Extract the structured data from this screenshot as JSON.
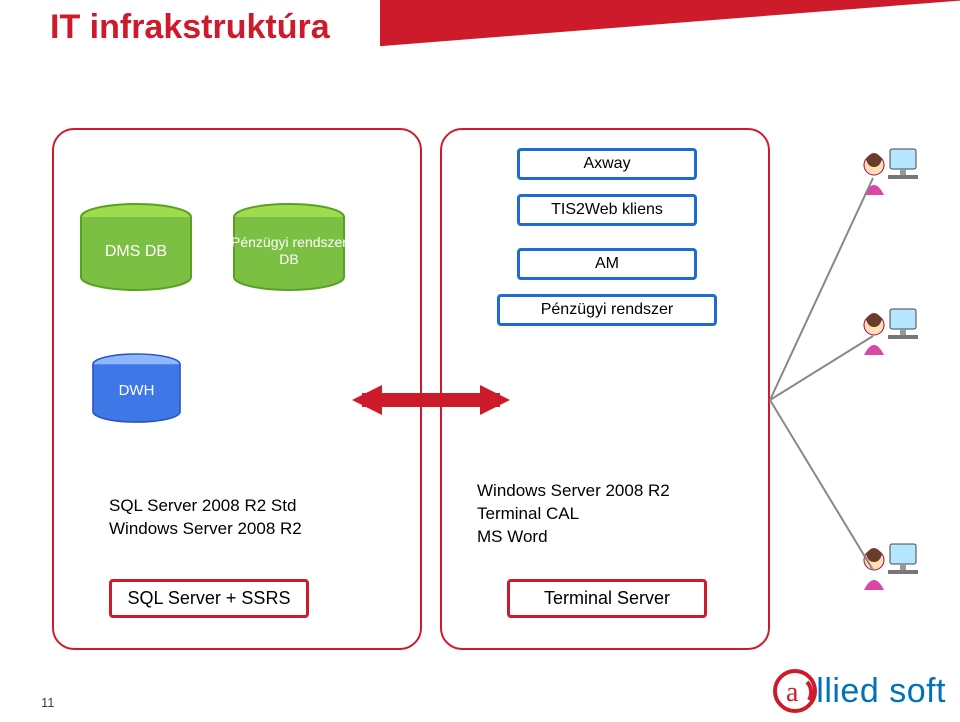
{
  "title": "IT infrakstruktúra",
  "page_number": "11",
  "logo_text": "llied soft",
  "left_panel": {
    "db_dms": "DMS DB",
    "db_fin": "Pénzügyi rendszer DB",
    "db_dwh": "DWH",
    "sql_line1": "SQL Server 2008 R2 Std",
    "sql_line2": "Windows Server 2008 R2",
    "footer_box": "SQL Server + SSRS"
  },
  "right_panel": {
    "box_axway": "Axway",
    "box_tis2web": "TIS2Web kliens",
    "box_am": "AM",
    "box_fin": "Pénzügyi rendszer",
    "win_line1": "Windows Server 2008 R2",
    "win_line2": "Terminal CAL",
    "win_line3": "MS Word",
    "footer_box": "Terminal Server"
  },
  "users": [
    "user-top",
    "user-middle",
    "user-bottom"
  ]
}
